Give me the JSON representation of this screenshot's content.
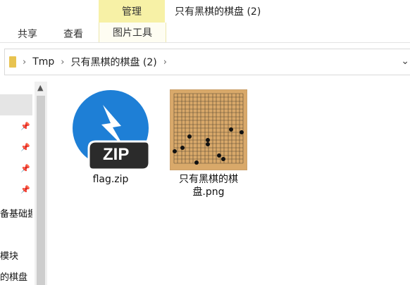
{
  "ribbon": {
    "contextual_tab": "管理",
    "window_title": "只有黑棋的棋盘 (2)",
    "tabs": [
      "共享",
      "查看",
      "图片工具"
    ]
  },
  "address_bar": {
    "segments": [
      "Tmp",
      "只有黑棋的棋盘 (2)"
    ]
  },
  "nav_pane": {
    "items": [
      "备基础握",
      "模块",
      "的棋盘"
    ]
  },
  "files": [
    {
      "name": "flag.zip",
      "icon": "zip-archive-icon",
      "badge": "ZIP"
    },
    {
      "name": "只有黑棋的棋盘.png",
      "icon": "go-board-image-thumbnail"
    }
  ],
  "colors": {
    "manage_tab": "#f7f1a6",
    "zip_blue": "#1e7fd6",
    "board": "#d9a96a"
  }
}
